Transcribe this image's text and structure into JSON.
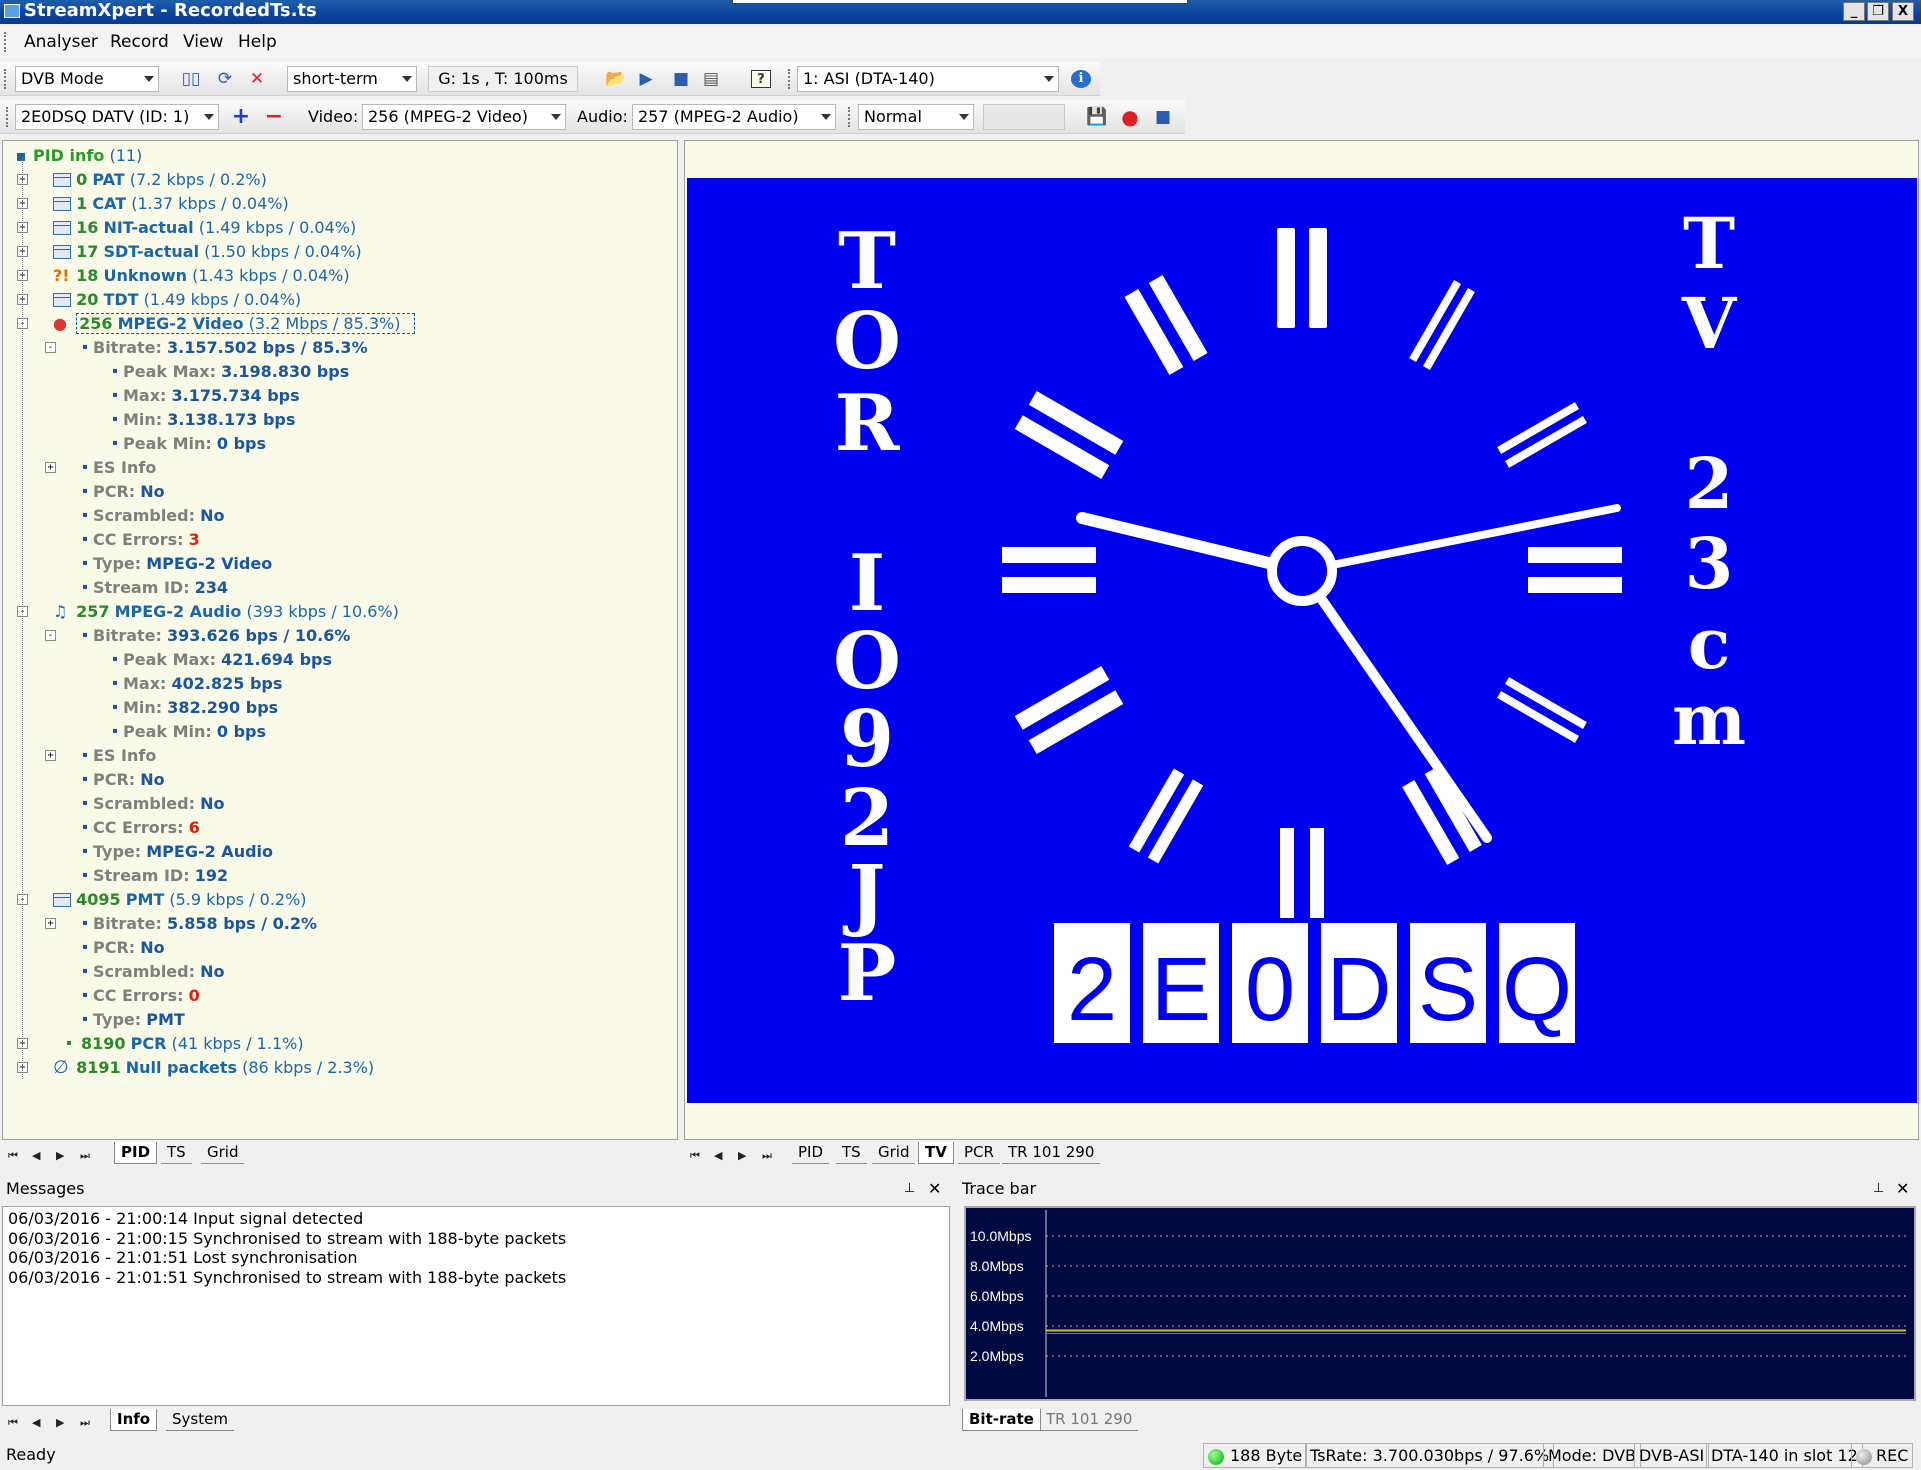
{
  "window": {
    "title": "StreamXpert - RecordedTs.ts",
    "min": "_",
    "restore": "❐",
    "close": "X"
  },
  "menu": [
    "Analyser",
    "Record",
    "View",
    "Help"
  ],
  "toolbar1": {
    "mode": "DVB Mode",
    "interval": "short-term",
    "timing": "G: 1s , T: 100ms",
    "device": "1: ASI (DTA-140)"
  },
  "toolbar2": {
    "service": "2E0DSQ DATV (ID: 1)",
    "video_label": "Video:",
    "video": "256 (MPEG-2 Video)",
    "audio_label": "Audio:",
    "audio": "257 (MPEG-2 Audio)",
    "speed": "Normal"
  },
  "tree": {
    "root": {
      "label": "PID info",
      "count": "(11)"
    },
    "pids": [
      {
        "num": "0",
        "name": "PAT",
        "stat": "(7.2 kbps / 0.2%)"
      },
      {
        "num": "1",
        "name": "CAT",
        "stat": "(1.37 kbps / 0.04%)"
      },
      {
        "num": "16",
        "name": "NIT-actual",
        "stat": "(1.49 kbps / 0.04%)"
      },
      {
        "num": "17",
        "name": "SDT-actual",
        "stat": "(1.50 kbps / 0.04%)"
      },
      {
        "num": "18",
        "name": "Unknown",
        "stat": "(1.43 kbps / 0.04%)"
      },
      {
        "num": "20",
        "name": "TDT",
        "stat": "(1.49 kbps / 0.04%)"
      }
    ],
    "video": {
      "num": "256",
      "name": "MPEG-2 Video",
      "stat": "(3.2 Mbps / 85.3%)",
      "bitrate_label": "Bitrate:",
      "bitrate": "3.157.502 bps / 85.3%",
      "peakmax_label": "Peak Max:",
      "peakmax": "3.198.830 bps",
      "max_label": "Max:",
      "max": "3.175.734 bps",
      "min_label": "Min:",
      "min": "3.138.173 bps",
      "peakmin_label": "Peak Min:",
      "peakmin": "0 bps",
      "es_label": "ES Info",
      "pcr_label": "PCR:",
      "pcr": "No",
      "scr_label": "Scrambled:",
      "scr": "No",
      "cc_label": "CC Errors:",
      "cc": "3",
      "type_label": "Type:",
      "type": "MPEG-2 Video",
      "sid_label": "Stream ID:",
      "sid": "234"
    },
    "audio": {
      "num": "257",
      "name": "MPEG-2 Audio",
      "stat": "(393 kbps / 10.6%)",
      "bitrate_label": "Bitrate:",
      "bitrate": "393.626 bps / 10.6%",
      "peakmax_label": "Peak Max:",
      "peakmax": "421.694 bps",
      "max_label": "Max:",
      "max": "402.825 bps",
      "min_label": "Min:",
      "min": "382.290 bps",
      "peakmin_label": "Peak Min:",
      "peakmin": "0 bps",
      "es_label": "ES Info",
      "pcr_label": "PCR:",
      "pcr": "No",
      "scr_label": "Scrambled:",
      "scr": "No",
      "cc_label": "CC Errors:",
      "cc": "6",
      "type_label": "Type:",
      "type": "MPEG-2 Audio",
      "sid_label": "Stream ID:",
      "sid": "192"
    },
    "pmt": {
      "num": "4095",
      "name": "PMT",
      "stat": "(5.9 kbps / 0.2%)",
      "bitrate_label": "Bitrate:",
      "bitrate": "5.858 bps / 0.2%",
      "pcr_label": "PCR:",
      "pcr": "No",
      "scr_label": "Scrambled:",
      "scr": "No",
      "cc_label": "CC Errors:",
      "cc": "0",
      "type_label": "Type:",
      "type": "PMT"
    },
    "pcr": {
      "num": "8190",
      "name": "PCR",
      "stat": "(41 kbps / 1.1%)"
    },
    "nullp": {
      "num": "8191",
      "name": "Null packets",
      "stat": "(86 kbps / 2.3%)"
    }
  },
  "left_tabs": [
    "PID",
    "TS",
    "Grid"
  ],
  "right_tabs": [
    "PID",
    "TS",
    "Grid",
    "TV",
    "PCR",
    "TR 101 290"
  ],
  "tv": {
    "left_text": "TOR IO92JP",
    "right_text": "TV 23cm",
    "callsign": [
      "2",
      "E",
      "0",
      "D",
      "S",
      "Q"
    ],
    "bg": "#0000f0"
  },
  "messages": {
    "title": "Messages",
    "pin": "⊥",
    "close": "✕",
    "lines": [
      "06/03/2016 - 21:00:14 Input signal detected",
      "06/03/2016 - 21:00:15 Synchronised to stream with 188-byte packets",
      "06/03/2016 - 21:01:51 Lost synchronisation",
      "06/03/2016 - 21:01:51 Synchronised to stream with 188-byte packets"
    ],
    "tabs": [
      "Info",
      "System"
    ]
  },
  "trace": {
    "title": "Trace bar",
    "pin": "⊥",
    "close": "✕",
    "ylabels": [
      "10.0Mbps",
      "8.0Mbps",
      "6.0Mbps",
      "4.0Mbps",
      "2.0Mbps"
    ],
    "level_mbps": 3.7,
    "tabs": [
      "Bit-rate",
      "TR 101 290"
    ]
  },
  "status": {
    "ready": "Ready",
    "packet": "188 Byte",
    "tsrate": "TsRate: 3.700.030bps / 97.6%",
    "mode": "Mode: DVB",
    "iface": "DVB-ASI",
    "slot": "DTA-140 in slot 12",
    "rec": "REC"
  }
}
